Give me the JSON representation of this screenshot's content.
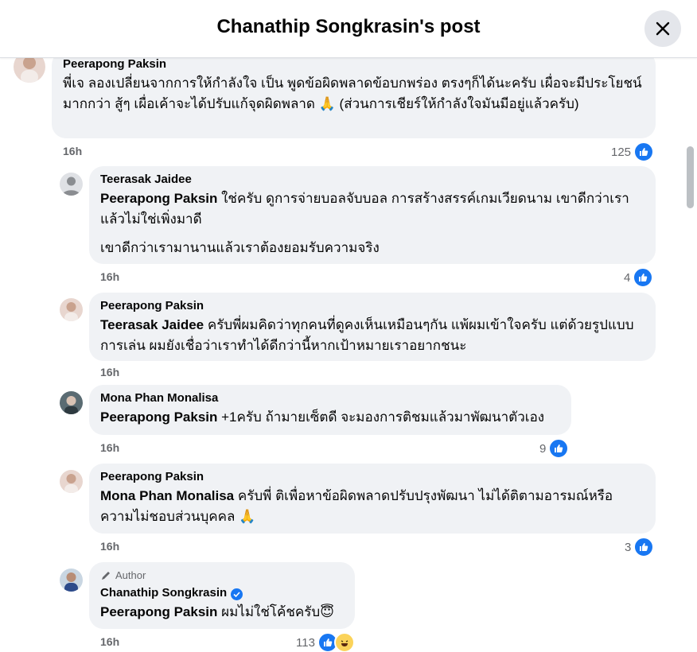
{
  "header": {
    "title": "Chanathip Songkrasin's post"
  },
  "comments": [
    {
      "author": "Peerapong Paksin",
      "text": "พี่เจ ลองเปลี่ยนจากการให้กำลังใจ เป็น พูดข้อผิดพลาดข้อบกพร่อง ตรงๆก็ได้นะครับ เผื่อจะมีประโยชน์มากกว่า สู้ๆ เผื่อเค้าจะได้ปรับแก้จุดผิดพลาด 🙏 (ส่วนการเชียร์ให้กำลังใจมันมีอยู่แล้วครับ)",
      "time": "16h",
      "reactions": "125"
    },
    {
      "author": "Teerasak Jaidee",
      "mention": "Peerapong Paksin",
      "text": " ใช่ครับ ดูการจ่ายบอลจับบอล การสร้างสรรค์เกมเวียดนาม เขาดีกว่าเราแล้วไม่ใช่เพิ่งมาดี",
      "text2": "เขาดีกว่าเรามานานแล้วเราต้องยอมรับความจริง",
      "time": "16h",
      "reactions": "4"
    },
    {
      "author": "Peerapong Paksin",
      "mention": "Teerasak Jaidee",
      "text": " ครับพี่ผมคิดว่าทุกคนที่ดูคงเห็นเหมือนๆกัน แพ้ผมเข้าใจครับ แต่ด้วยรูปแบบการเล่น ผมยังเชื่อว่าเราทำได้ดีกว่านี้หากเป้าหมายเราอยากชนะ",
      "time": "16h"
    },
    {
      "author": "Mona Phan Monalisa",
      "mention": "Peerapong Paksin",
      "text": " +1ครับ ถ้ามายเซ็ตดี จะมองการติชมแล้วมาพัฒนาตัวเอง",
      "time": "16h",
      "reactions": "9"
    },
    {
      "author": "Peerapong Paksin",
      "mention": "Mona Phan Monalisa",
      "text": " ครับพี่ ติเพื่อหาข้อผิดพลาดปรับปรุงพัฒนา ไม่ได้ติตามอารมณ์หรือความไม่ชอบส่วนบุคคล 🙏",
      "time": "16h",
      "reactions": "3"
    },
    {
      "badge": "Author",
      "author": "Chanathip Songkrasin",
      "mention": "Peerapong Paksin",
      "text": " ผมไม่ใช่โค้ชครับ😇",
      "time": "16h",
      "reactions": "113"
    }
  ],
  "icons": {
    "close": "close-icon",
    "like": "like-icon",
    "haha": "haha-icon",
    "verified": "verified-badge-icon",
    "author_badge": "pen-icon"
  },
  "colors": {
    "accent": "#1877f2",
    "bubble": "#f0f2f5",
    "meta": "#65676b"
  }
}
